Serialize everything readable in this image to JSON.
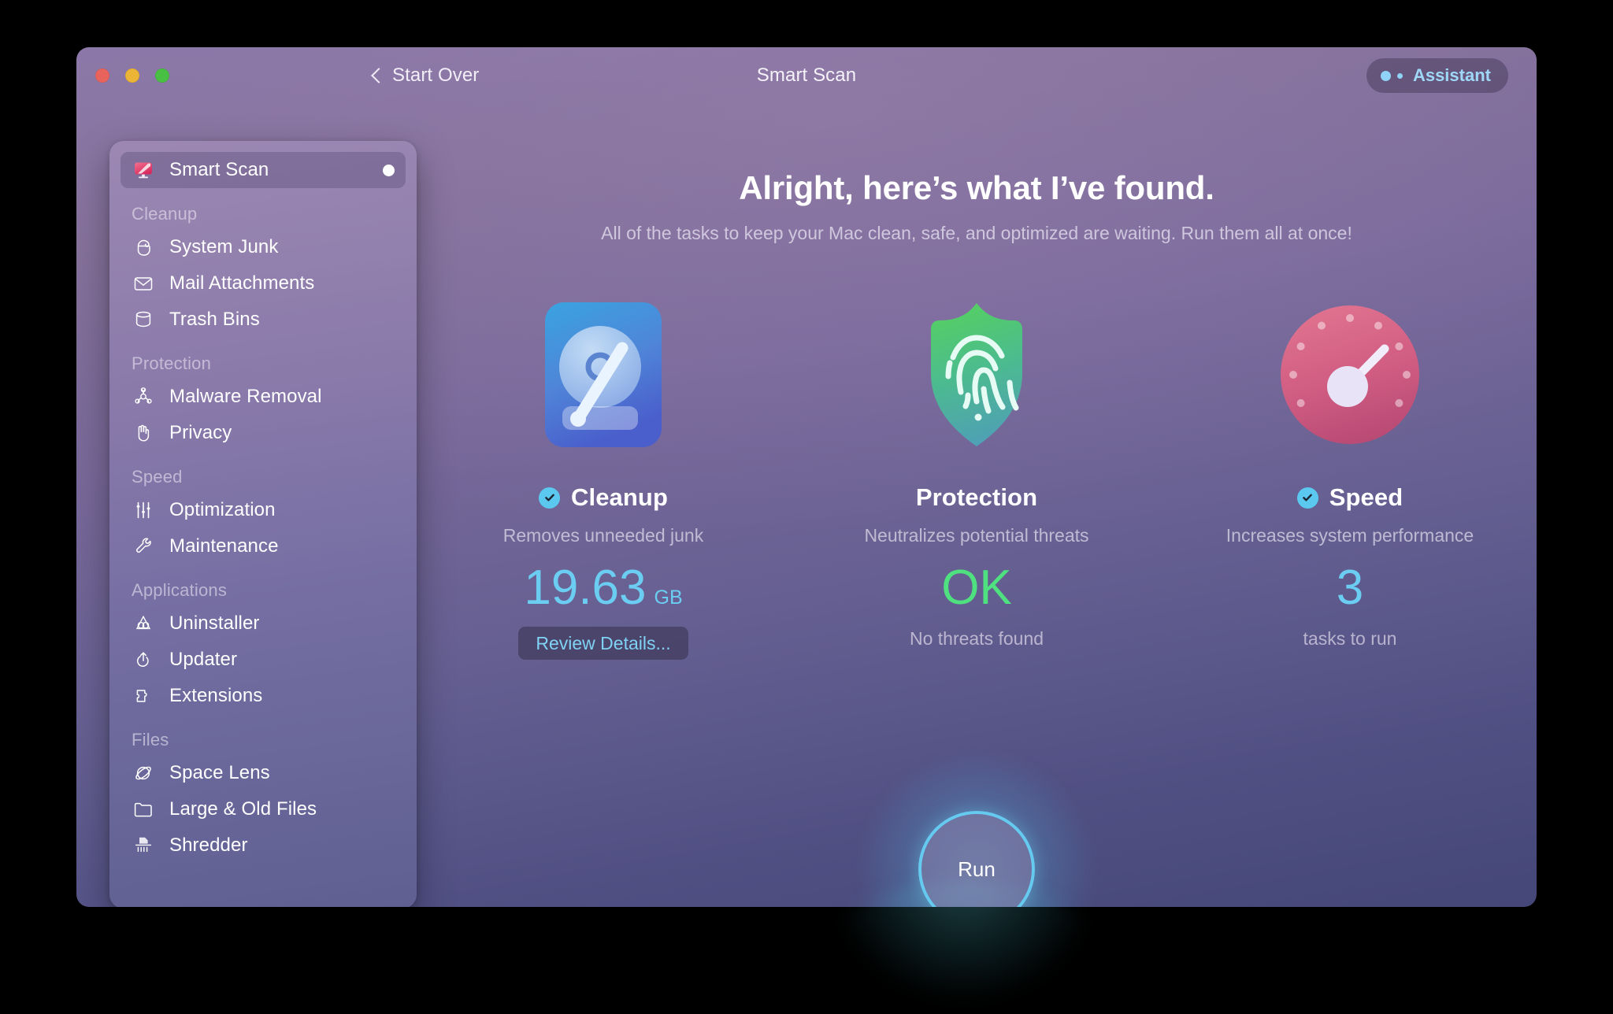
{
  "window": {
    "title": "Smart Scan",
    "back_label": "Start Over",
    "assistant_label": "Assistant",
    "traffic_lights": [
      "close",
      "minimize",
      "zoom"
    ]
  },
  "sidebar": {
    "items": [
      {
        "label": "Smart Scan",
        "icon": "smart-scan-icon",
        "selected": true,
        "badge_dot": true
      }
    ],
    "groups": [
      {
        "title": "Cleanup",
        "items": [
          {
            "label": "System Junk",
            "icon": "system-junk-icon"
          },
          {
            "label": "Mail Attachments",
            "icon": "mail-icon"
          },
          {
            "label": "Trash Bins",
            "icon": "trash-bin-icon"
          }
        ]
      },
      {
        "title": "Protection",
        "items": [
          {
            "label": "Malware Removal",
            "icon": "biohazard-icon"
          },
          {
            "label": "Privacy",
            "icon": "hand-icon"
          }
        ]
      },
      {
        "title": "Speed",
        "items": [
          {
            "label": "Optimization",
            "icon": "sliders-icon"
          },
          {
            "label": "Maintenance",
            "icon": "wrench-icon"
          }
        ]
      },
      {
        "title": "Applications",
        "items": [
          {
            "label": "Uninstaller",
            "icon": "uninstaller-icon"
          },
          {
            "label": "Updater",
            "icon": "updater-icon"
          },
          {
            "label": "Extensions",
            "icon": "puzzle-icon"
          }
        ]
      },
      {
        "title": "Files",
        "items": [
          {
            "label": "Space Lens",
            "icon": "space-lens-icon"
          },
          {
            "label": "Large & Old Files",
            "icon": "folder-icon"
          },
          {
            "label": "Shredder",
            "icon": "shredder-icon"
          }
        ]
      }
    ]
  },
  "main": {
    "headline": "Alright, here’s what I’ve found.",
    "subhead": "All of the tasks to keep your Mac clean, safe, and optimized are waiting. Run them all at once!",
    "cards": [
      {
        "id": "cleanup",
        "title": "Cleanup",
        "checked": true,
        "subtitle": "Removes unneeded junk",
        "value": "19.63",
        "unit": "GB",
        "value_color": "#6bcdf2",
        "footer": "",
        "button_label": "Review Details...",
        "icon": "hard-drive-icon"
      },
      {
        "id": "protection",
        "title": "Protection",
        "checked": false,
        "subtitle": "Neutralizes potential threats",
        "value": "OK",
        "unit": "",
        "value_color": "#4fe080",
        "footer": "No threats found",
        "button_label": "",
        "icon": "shield-fingerprint-icon"
      },
      {
        "id": "speed",
        "title": "Speed",
        "checked": true,
        "subtitle": "Increases system performance",
        "value": "3",
        "unit": "",
        "value_color": "#6bcdf2",
        "footer": "tasks to run",
        "button_label": "",
        "icon": "speedometer-icon"
      }
    ],
    "run_button_label": "Run"
  },
  "colors": {
    "accent_blue": "#6bcdf2",
    "accent_green": "#4fe080",
    "window_top": "#8a77a7",
    "window_bottom": "#454778",
    "sidebar_selected": "#6c5c86"
  }
}
